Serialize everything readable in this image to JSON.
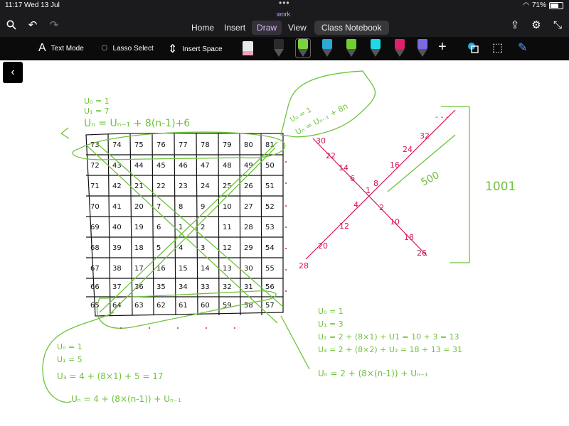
{
  "status": {
    "time": "11:17",
    "date": "Wed 13 Jul",
    "battery": "71%"
  },
  "notebook_title": "work",
  "tabs": [
    "Home",
    "Insert",
    "Draw",
    "View",
    "Class Notebook"
  ],
  "ribbon": {
    "text_mode": "Text Mode",
    "lasso_select": "Lasso Select",
    "insert_space": "Insert Space",
    "add": "+"
  },
  "pens": [
    {
      "name": "black-pen",
      "color": "#2b2b2b"
    },
    {
      "name": "green-pen",
      "color": "#78d33c"
    },
    {
      "name": "blue-pen",
      "color": "#2aa9d6"
    },
    {
      "name": "lime-pen",
      "color": "#6fcf2f"
    },
    {
      "name": "cyan-highlighter",
      "color": "#20d8e8"
    },
    {
      "name": "pink-pen",
      "color": "#e0206a"
    },
    {
      "name": "purple-pen",
      "color": "#7a6be0"
    }
  ],
  "grid_numbers": [
    [
      "73",
      "74",
      "75",
      "76",
      "77",
      "78",
      "79",
      "80",
      "81"
    ],
    [
      "72",
      "43",
      "44",
      "45",
      "46",
      "47",
      "48",
      "49",
      "50"
    ],
    [
      "71",
      "42",
      "21",
      "22",
      "23",
      "24",
      "25",
      "26",
      "51"
    ],
    [
      "70",
      "41",
      "20",
      "7",
      "8",
      "9",
      "10",
      "27",
      "52"
    ],
    [
      "69",
      "40",
      "19",
      "6",
      "1",
      "2",
      "11",
      "28",
      "53"
    ],
    [
      "68",
      "39",
      "18",
      "5",
      "4",
      "3",
      "12",
      "29",
      "54"
    ],
    [
      "67",
      "38",
      "17",
      "16",
      "15",
      "14",
      "13",
      "30",
      "55"
    ],
    [
      "66",
      "37",
      "36",
      "35",
      "34",
      "33",
      "32",
      "31",
      "56"
    ],
    [
      "65",
      "64",
      "63",
      "62",
      "61",
      "60",
      "59",
      "58",
      "57"
    ]
  ],
  "notes": {
    "top_left": [
      "U₀ = 1",
      "U₁ = 7",
      "Uₙ = Uₙ₋₁ + 8(n-1)+6"
    ],
    "top_right": [
      "U₀ = 1",
      "Uₙ = Uₙ₋₁ + 8n"
    ],
    "bottom_left": [
      "U₀ = 1",
      "U₁ = 5",
      "U₃ = 4 + (8×1) + 5 = 17",
      "Uₙ = 4 + (8×(n-1)) + Uₙ₋₁"
    ],
    "bottom_right": [
      "U₀ = 1",
      "U₁ = 3",
      "U₂ = 2 + (8×1) + U1 = 10 + 3 = 13",
      "U₃ = 2 + (8×2) + U₂ = 18 + 13 = 31",
      "Uₙ = 2 + (8×(n-1)) + Uₙ₋₁"
    ],
    "bracket_label": "1001",
    "diag_label": "500"
  },
  "pink_numbers": [
    "30",
    "22",
    "14",
    "6",
    "8",
    "16",
    "24",
    "32",
    "- - -",
    "2",
    "10",
    "18",
    "26",
    "4",
    "12",
    "20",
    "28",
    "1"
  ]
}
